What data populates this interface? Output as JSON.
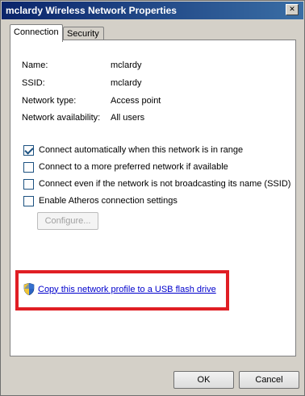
{
  "window": {
    "title": "mclardy Wireless Network Properties",
    "close_glyph": "✕"
  },
  "tabs": [
    {
      "label": "Connection",
      "active": true
    },
    {
      "label": "Security",
      "active": false
    }
  ],
  "properties": [
    {
      "label": "Name:",
      "value": "mclardy"
    },
    {
      "label": "SSID:",
      "value": "mclardy"
    },
    {
      "label": "Network type:",
      "value": "Access point"
    },
    {
      "label": "Network availability:",
      "value": "All users"
    }
  ],
  "options": [
    {
      "label": "Connect automatically when this network is in range",
      "checked": true
    },
    {
      "label": "Connect to a more preferred network if available",
      "checked": false
    },
    {
      "label": "Connect even if the network is not broadcasting its name (SSID)",
      "checked": false
    },
    {
      "label": "Enable Atheros connection settings",
      "checked": false
    }
  ],
  "configure_button": "Configure...",
  "copy_link": "Copy this network profile to a USB flash drive",
  "footer": {
    "ok_label": "OK",
    "cancel_label": "Cancel"
  },
  "colors": {
    "highlight_border": "#e01e24",
    "link": "#0000cc",
    "title_bar": "#0a246a"
  }
}
